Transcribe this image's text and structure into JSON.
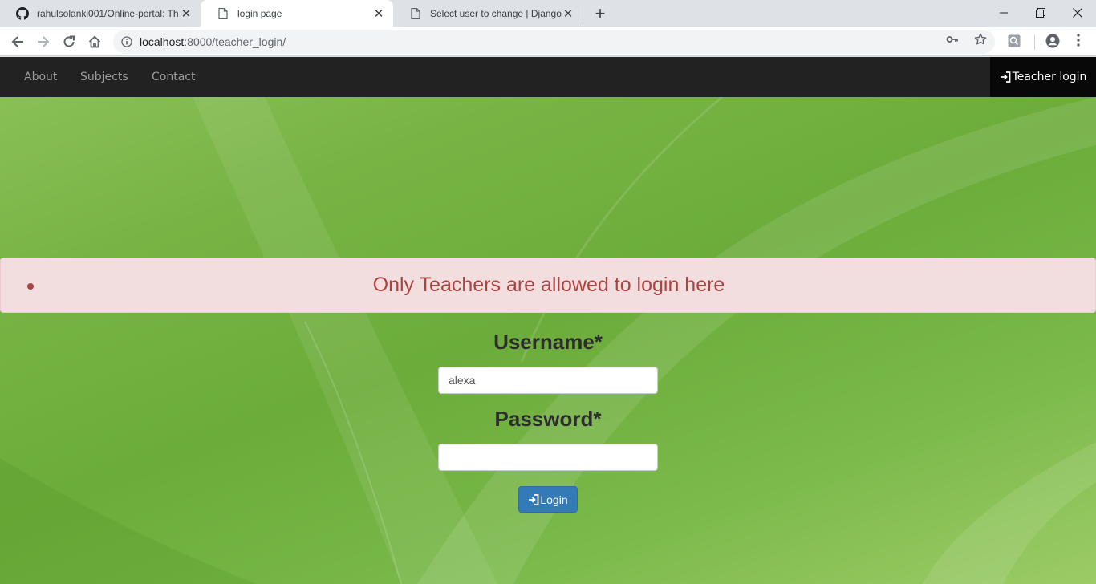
{
  "browser": {
    "tabs": [
      {
        "title": "rahulsolanki001/Online-portal: Th",
        "icon": "github-icon",
        "active": false
      },
      {
        "title": "login page",
        "icon": "page-icon",
        "active": true
      },
      {
        "title": "Select user to change | Django si",
        "icon": "page-icon",
        "active": false
      }
    ],
    "url_host": "localhost",
    "url_path": ":8000/teacher_login/"
  },
  "navbar": {
    "links": [
      "About",
      "Subjects",
      "Contact"
    ],
    "right_label": "Teacher login",
    "right_icon": "log-in-icon"
  },
  "alert": {
    "message": "Only Teachers are allowed to login here",
    "color": "#a94442",
    "background": "#f2dede"
  },
  "form": {
    "username_label": "Username*",
    "username_value": "alexa",
    "password_label": "Password*",
    "password_value": "",
    "login_label": "Login",
    "login_icon": "log-in-icon",
    "button_color": "#337ab7"
  }
}
